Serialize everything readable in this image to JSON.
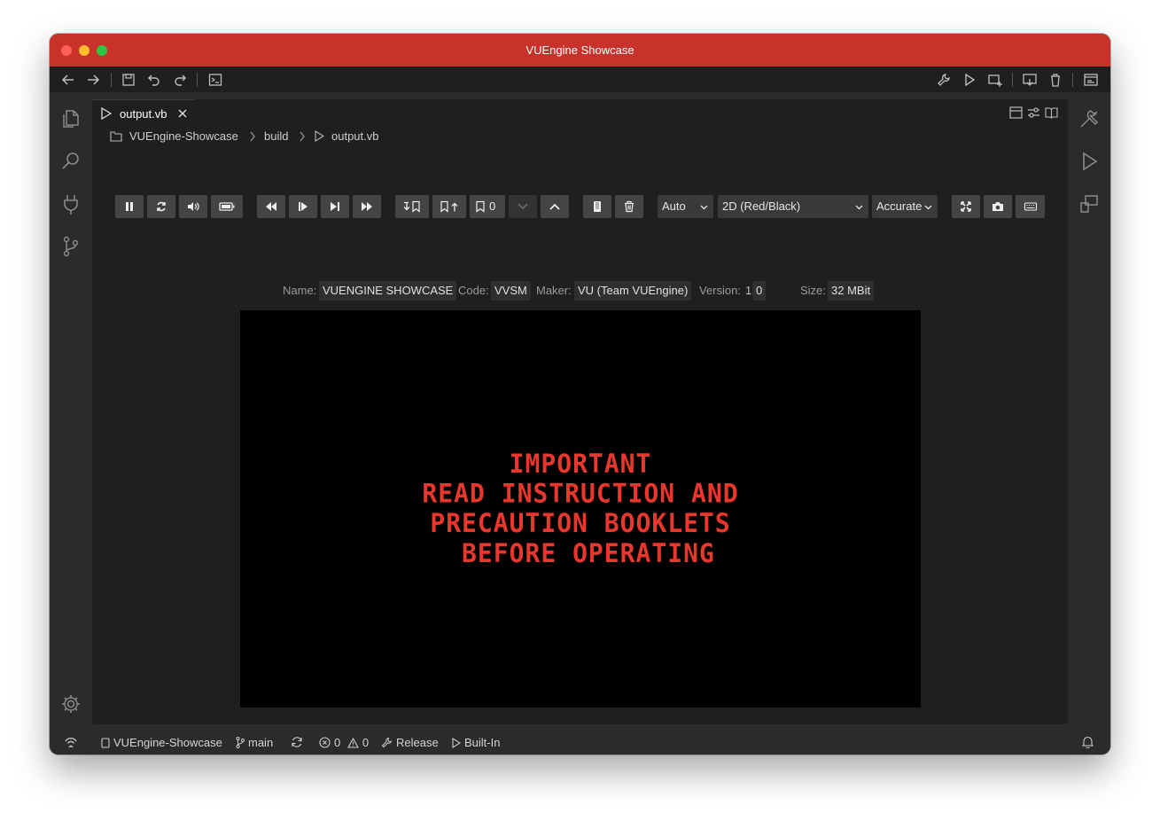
{
  "window": {
    "title": "VUEngine Showcase"
  },
  "tab": {
    "label": "output.vb"
  },
  "breadcrumb": [
    "VUEngine-Showcase",
    "build",
    "output.vb"
  ],
  "emulator": {
    "bookmark_count": "0",
    "scale_select": "Auto",
    "mode_select": "2D (Red/Black)",
    "accuracy_select": "Accurate"
  },
  "rom_info": {
    "name_label": "Name:",
    "name_value": "VUENGINE SHOWCASE",
    "code_label": "Code:",
    "code_value": "VVSM",
    "maker_label": "Maker:",
    "maker_value": "VU (Team VUEngine)",
    "version_label": "Version:",
    "version_major": "1.",
    "version_minor": "0",
    "size_label": "Size:",
    "size_value": "32 MBit"
  },
  "screen": {
    "line1": "IMPORTANT",
    "line2": "READ INSTRUCTION AND",
    "line3": "PRECAUTION BOOKLETS",
    "line4": " BEFORE OPERATING"
  },
  "statusbar": {
    "project": "VUEngine-Showcase",
    "branch": "main",
    "errors": "0",
    "warnings": "0",
    "build_mode": "Release",
    "emulator": "Built-In"
  },
  "colors": {
    "titlebar": "#c8322b",
    "screen_text": "#e8372c",
    "screen_bg": "#000000"
  },
  "icons": [
    "back-icon",
    "forward-icon",
    "save-icon",
    "undo-icon",
    "redo-icon",
    "terminal-icon",
    "wrench-icon",
    "run-icon",
    "add-target-icon",
    "flash-icon",
    "clean-icon",
    "settings-window-icon",
    "files-icon",
    "search-icon",
    "plug-icon",
    "source-control-icon",
    "gear-icon",
    "tools-icon",
    "emulator-icon",
    "devices-icon"
  ]
}
